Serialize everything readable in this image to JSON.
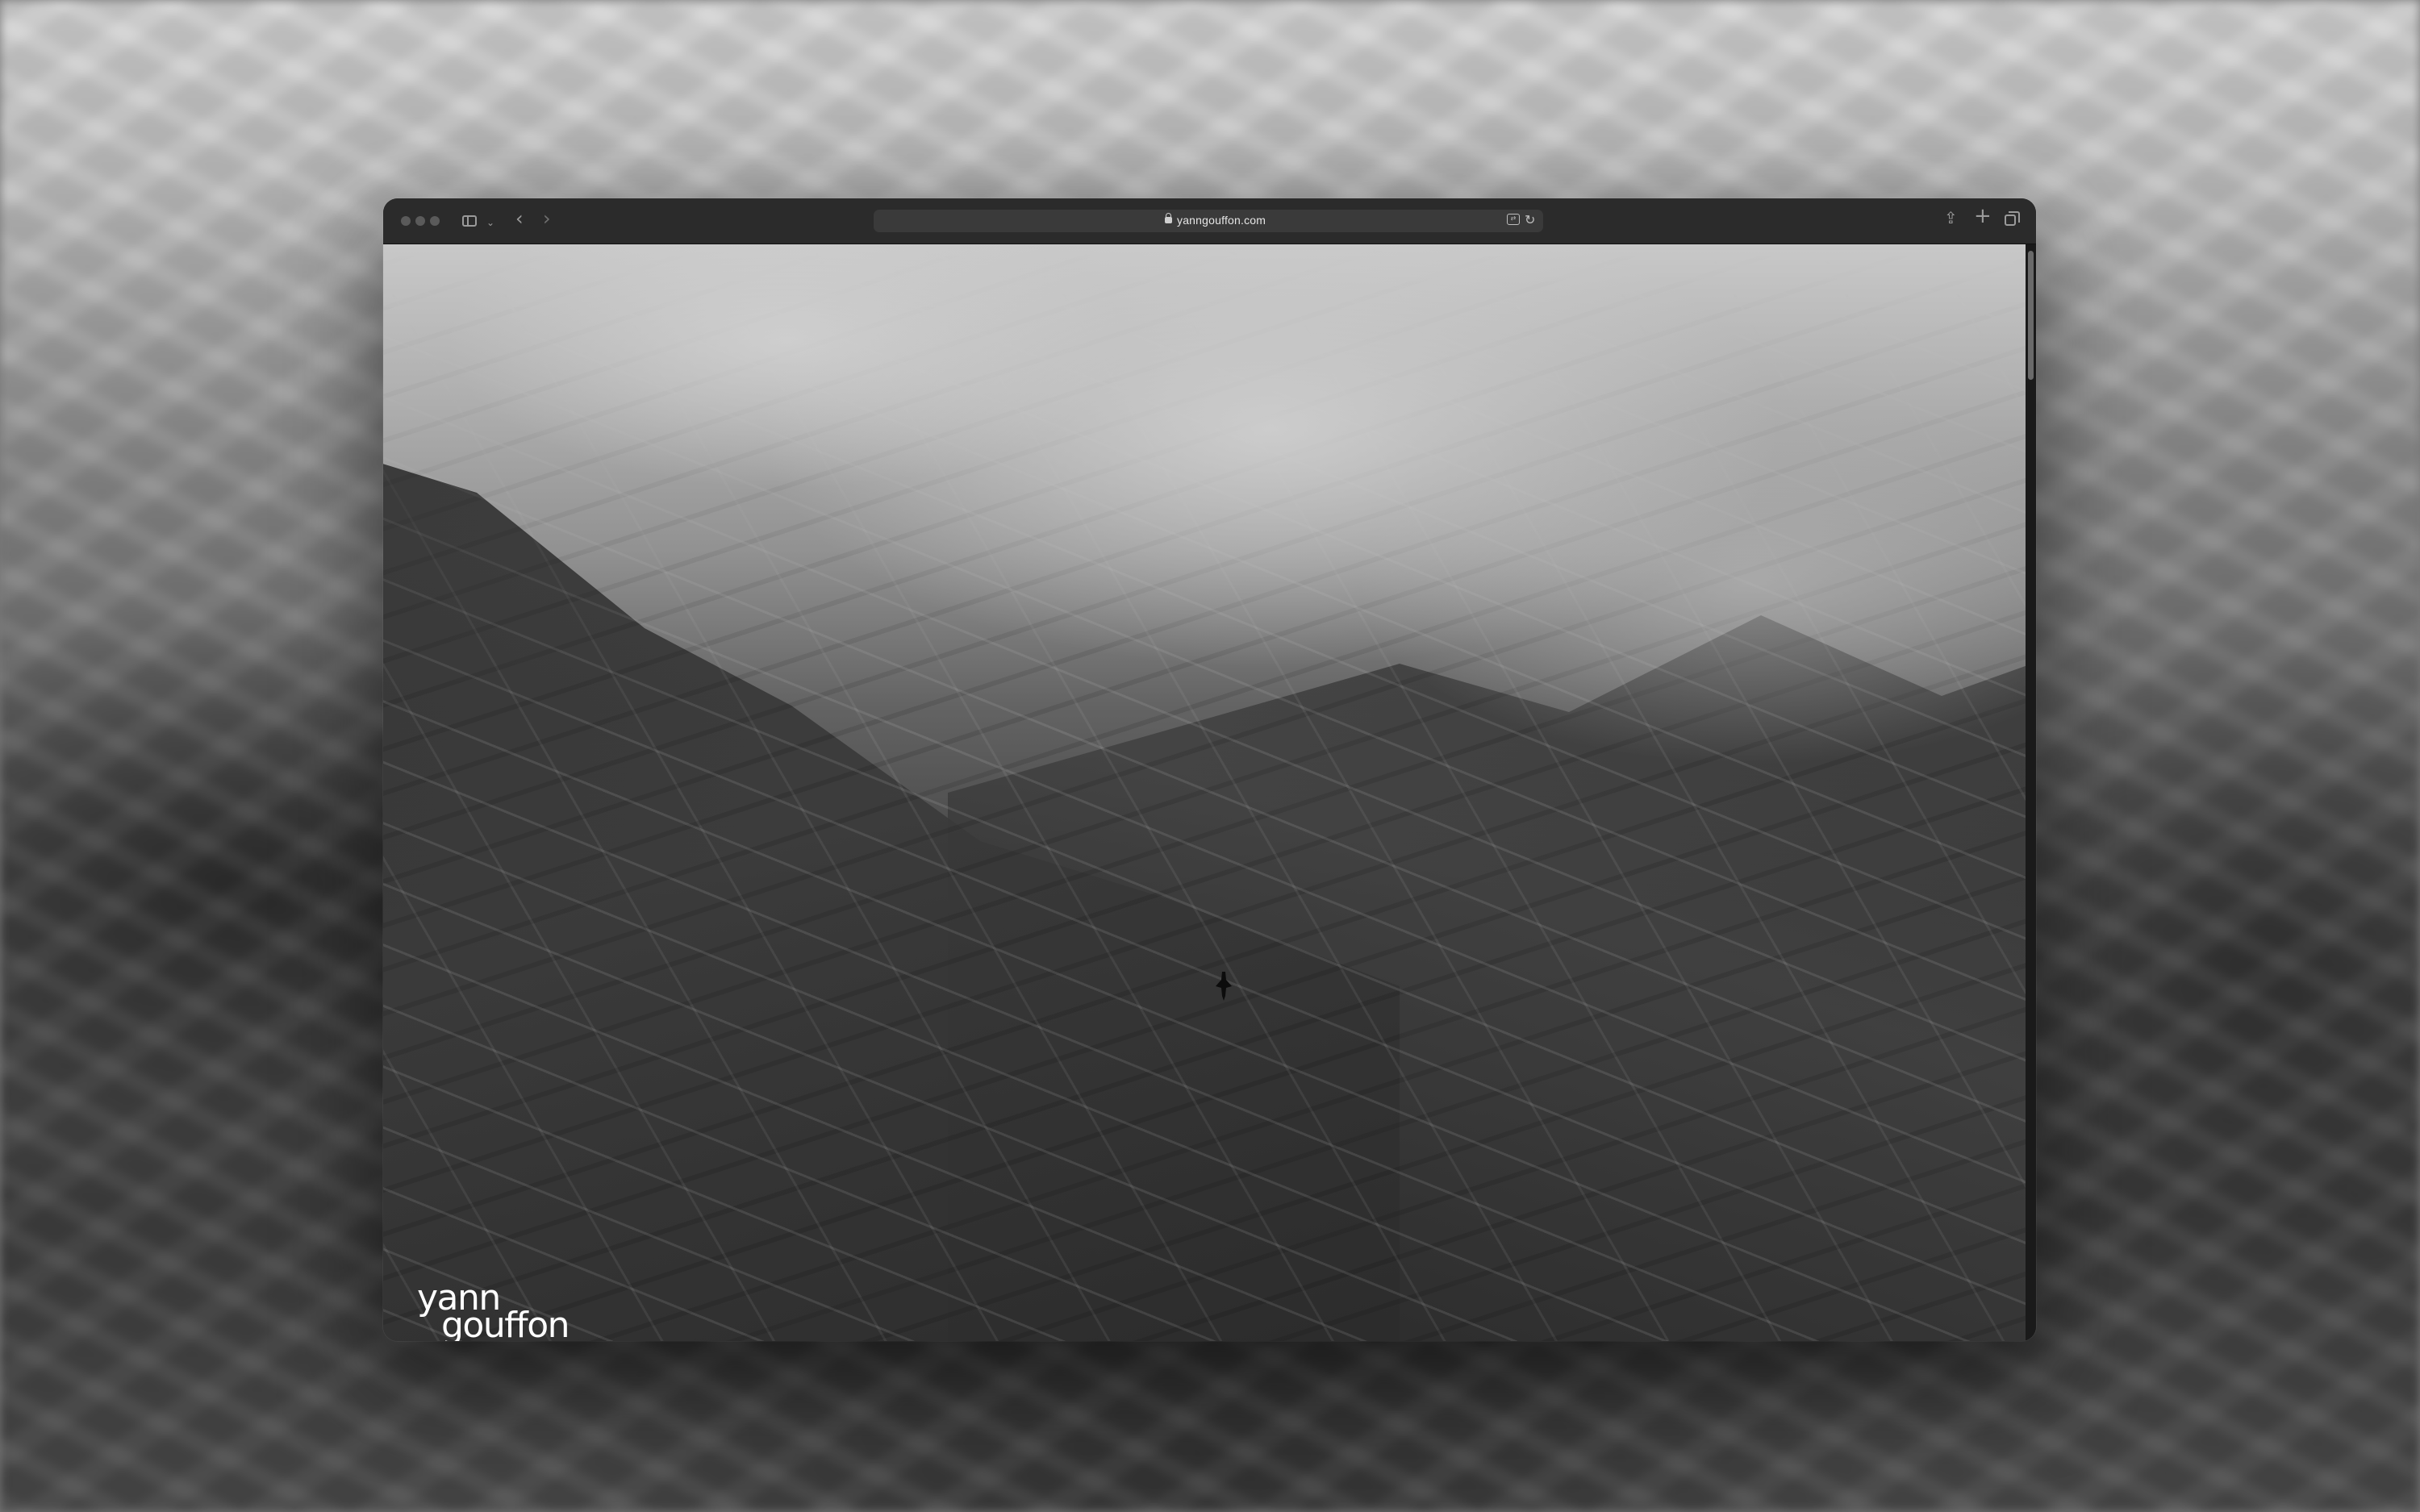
{
  "browser": {
    "url": "yanngouffon.com",
    "icons": {
      "sidebar": "sidebar-icon",
      "back": "chevron-left-icon",
      "forward": "chevron-right-icon",
      "lock": "lock-icon",
      "translate": "translate-icon",
      "reload": "reload-icon",
      "share": "share-icon",
      "new_tab": "plus-icon",
      "tabs_overview": "tabs-icon"
    }
  },
  "page": {
    "logo_line1": "yann",
    "logo_line2": "gouffon"
  },
  "colors": {
    "toolbar": "#2b2b2b",
    "address_bar": "#3a3a3a",
    "logo_text": "#ffffff"
  }
}
